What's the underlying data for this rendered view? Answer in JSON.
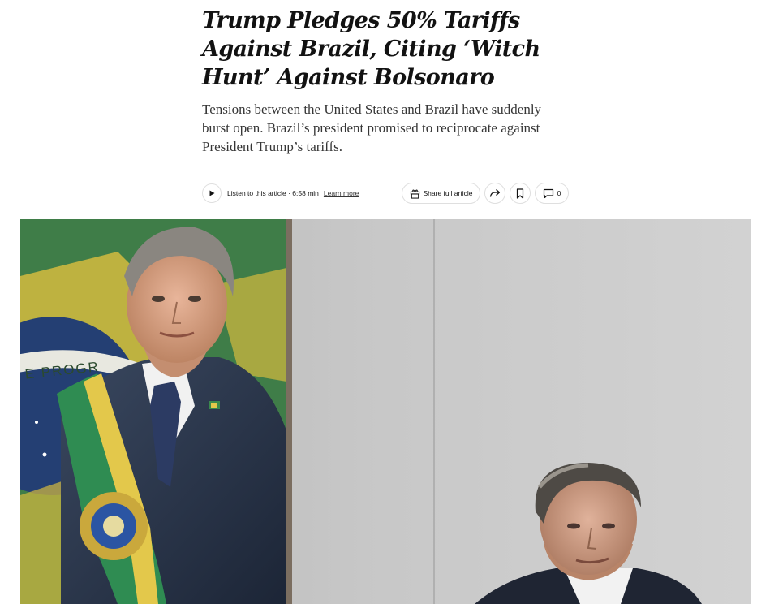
{
  "article": {
    "headline": "Trump Pledges 50% Tariffs Against Brazil, Citing ‘Witch Hunt’ Against Bolsonaro",
    "summary": "Tensions between the United States and Brazil have suddenly burst open. Brazil’s president promised to reciprocate against President Trump’s tariffs."
  },
  "toolbar": {
    "listen_label": "Listen to this article · 6:58 min",
    "learn_more": "Learn more",
    "share_full_label": "Share full article",
    "comment_count": "0",
    "icons": {
      "play": "play-icon",
      "gift": "gift-icon",
      "share": "share-arrow-icon",
      "save": "bookmark-icon",
      "comment": "comment-icon"
    }
  },
  "photo": {
    "flag_motto_fragment": "E PROGR"
  },
  "colors": {
    "text": "#121212",
    "muted": "#363636",
    "border": "#dfdfdf",
    "flag_green": "#2f7a3c",
    "flag_yellow": "#e2c64a",
    "flag_blue": "#1f3f74"
  }
}
